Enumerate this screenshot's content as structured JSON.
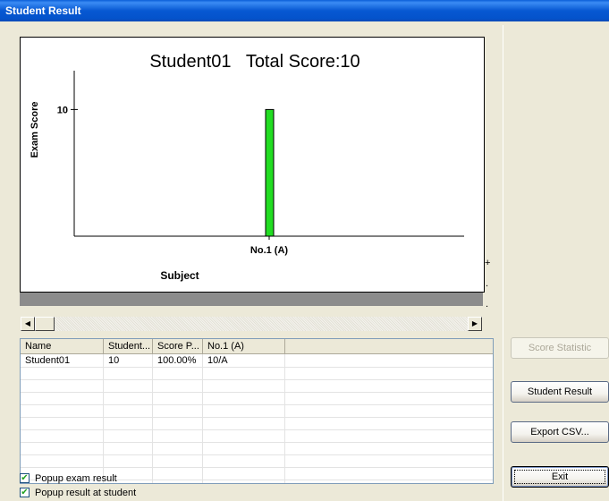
{
  "window": {
    "title": "Student Result"
  },
  "chart_data": {
    "type": "bar",
    "title": "Student01   Total Score:10",
    "xlabel": "Subject",
    "ylabel": "Exam Score",
    "categories": [
      "No.1 (A)"
    ],
    "values": [
      10
    ],
    "y_ticks": [
      "10"
    ],
    "ylim": [
      0,
      12.5
    ],
    "bar_color": "#22dd22",
    "grid": false,
    "legend": "none"
  },
  "side_marks": [
    "+",
    ".",
    "."
  ],
  "scrollbar": {
    "left_arrow": "◀",
    "right_arrow": "▶"
  },
  "table": {
    "columns": [
      "Name",
      "Student...",
      "Score P...",
      "No.1 (A)",
      ""
    ],
    "rows": [
      [
        "Student01",
        "10",
        "100.00%",
        "10/A"
      ]
    ]
  },
  "checkboxes": [
    {
      "label": "Popup exam result",
      "checked": true,
      "mark": "✔"
    },
    {
      "label": "Popup result at student",
      "checked": true,
      "mark": "✔"
    }
  ],
  "buttons": {
    "score_statistic": "Score Statistic",
    "student_result": "Student Result",
    "export_csv": "Export CSV...",
    "exit": "Exit"
  }
}
